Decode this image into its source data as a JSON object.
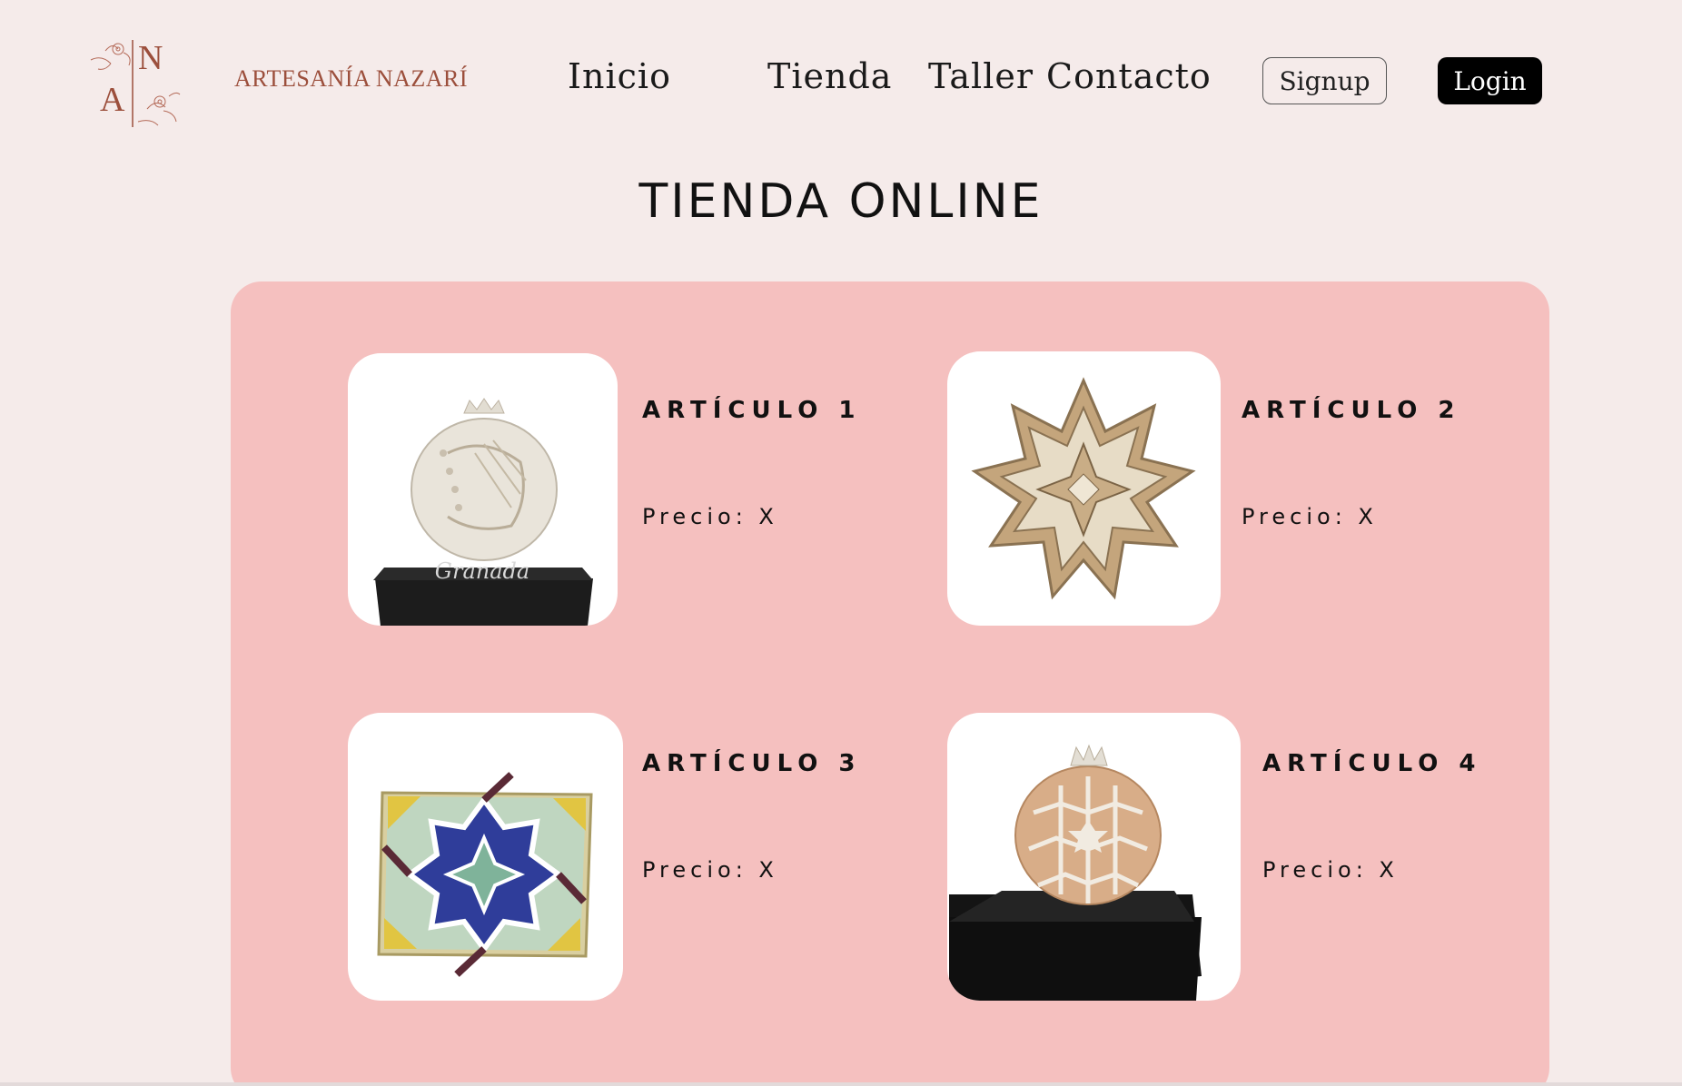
{
  "brand": {
    "logo_letters": [
      "N",
      "A"
    ],
    "name": "ARTESANÍA NAZARÍ",
    "color": "#9c4f3c"
  },
  "nav": {
    "items": [
      "Inicio",
      "Tienda",
      "Taller",
      "Contacto"
    ],
    "signup_label": "Signup",
    "login_label": "Login"
  },
  "page": {
    "title": "TIENDA ONLINE"
  },
  "products": [
    {
      "title": "ARTÍCULO 1",
      "price": "Precio: X",
      "image": "ceramic-pomegranate-granada"
    },
    {
      "title": "ARTÍCULO 2",
      "price": "Precio: X",
      "image": "star-plaster-ornament"
    },
    {
      "title": "ARTÍCULO 3",
      "price": "Precio: X",
      "image": "mosaic-tile"
    },
    {
      "title": "ARTÍCULO 4",
      "price": "Precio: X",
      "image": "geometric-pomegranate"
    }
  ],
  "image_texts": {
    "pomegranate_base": "Granada"
  },
  "colors": {
    "background": "#f5ebea",
    "panel": "#f5c0bf",
    "login_bg": "#000000"
  }
}
